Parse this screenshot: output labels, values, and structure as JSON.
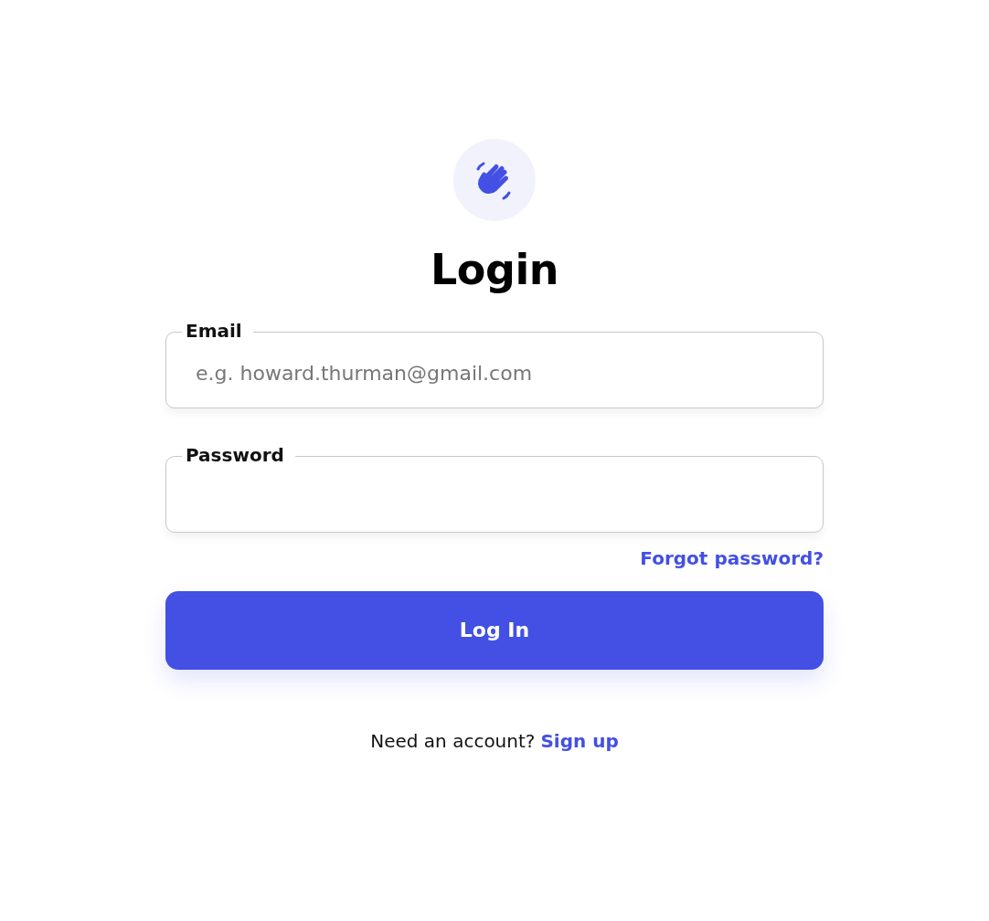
{
  "title": "Login",
  "fields": [
    {
      "label": "Email",
      "placeholder": "e.g. howard.thurman@gmail.com"
    },
    {
      "label": "Password"
    }
  ],
  "forgot_link": "Forgot password?",
  "submit_button": "Log In",
  "signup": {
    "text": "Need an account?",
    "link": "Sign up"
  }
}
